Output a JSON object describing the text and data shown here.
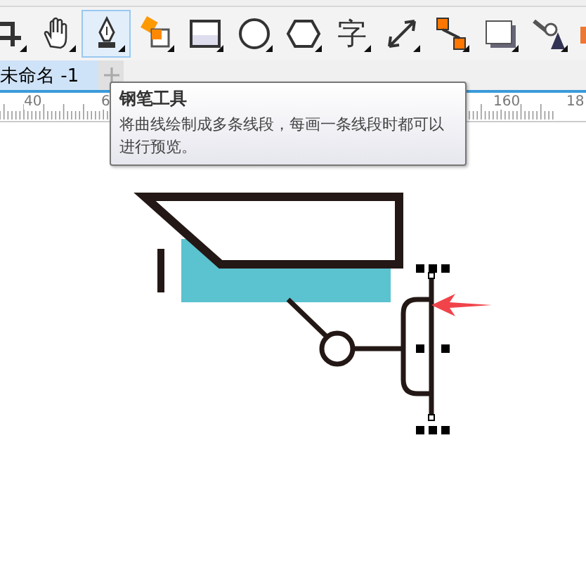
{
  "toolbox": [
    {
      "kind": "crop",
      "selected": false
    },
    {
      "kind": "hand",
      "selected": false
    },
    {
      "kind": "pen",
      "selected": true
    },
    {
      "kind": "smartfill",
      "selected": false
    },
    {
      "kind": "rectangle",
      "selected": false
    },
    {
      "kind": "ellipse",
      "selected": false
    },
    {
      "kind": "polygon",
      "selected": false
    },
    {
      "kind": "glyph",
      "label": "字",
      "selected": false
    },
    {
      "kind": "dimension",
      "selected": false
    },
    {
      "kind": "connector",
      "selected": false
    },
    {
      "kind": "shadow",
      "selected": false
    },
    {
      "kind": "eyedropper",
      "selected": false
    },
    {
      "kind": "partial",
      "selected": false
    }
  ],
  "tabs": [
    {
      "label": "未命名 -1",
      "selected": true
    }
  ],
  "ruler": {
    "labels": [
      "40",
      "6",
      "160",
      "18"
    ]
  },
  "tooltip": {
    "title": "钢笔工具",
    "text": "将曲线绘制成多条线段，每画一条线段时都可以进行预览。"
  }
}
